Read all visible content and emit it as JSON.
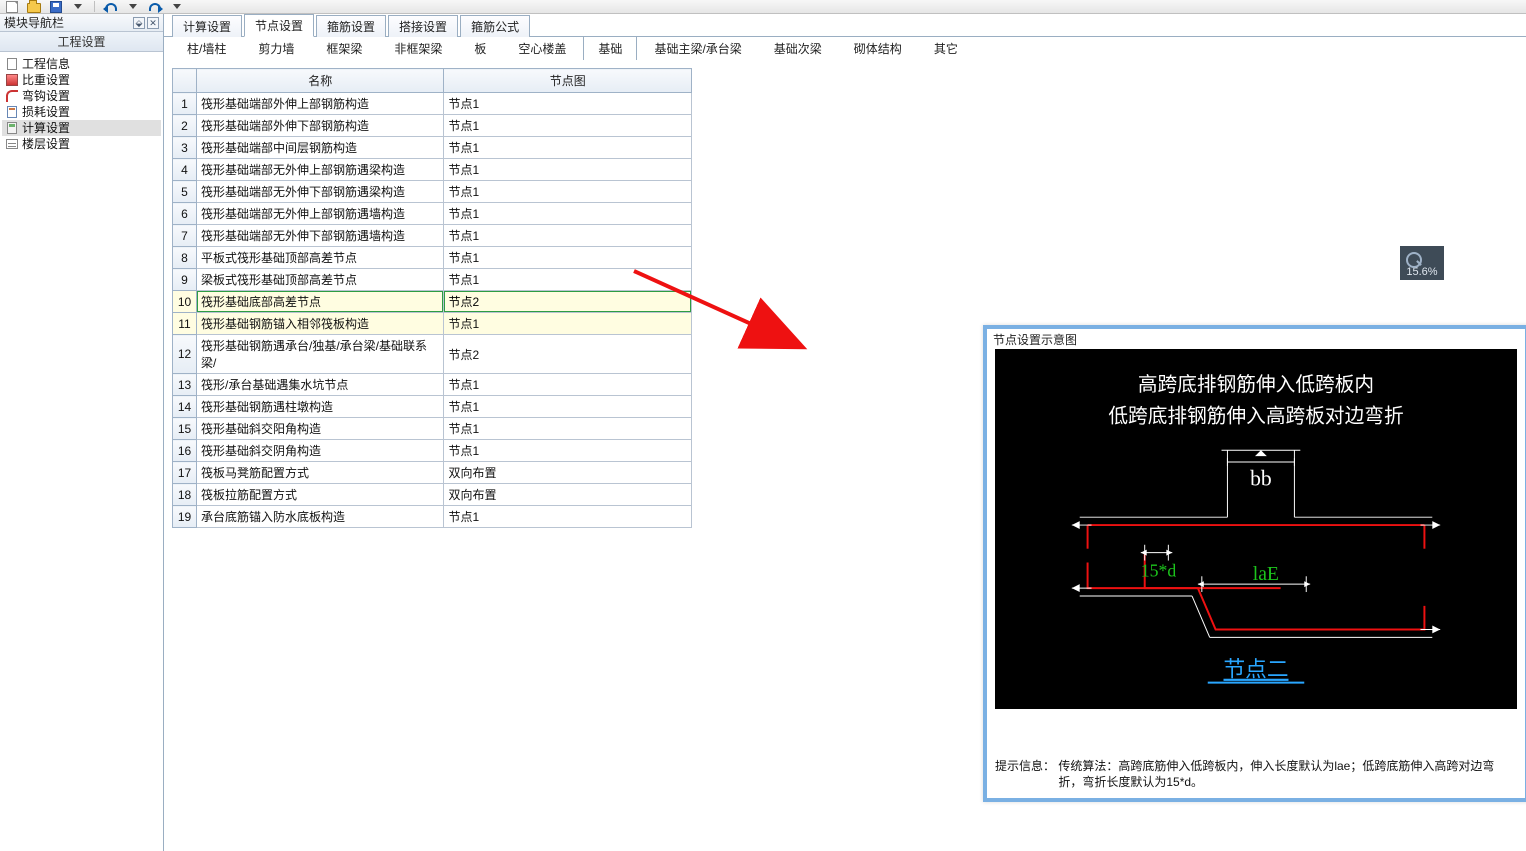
{
  "sidebar": {
    "title": "模块导航栏",
    "pin_glyph": "📌",
    "close_glyph": "✕",
    "title2": "工程设置",
    "items": [
      {
        "label": "工程信息"
      },
      {
        "label": "比重设置"
      },
      {
        "label": "弯钩设置"
      },
      {
        "label": "损耗设置"
      },
      {
        "label": "计算设置"
      },
      {
        "label": "楼层设置"
      }
    ]
  },
  "top_tabs": [
    {
      "label": "计算设置"
    },
    {
      "label": "节点设置"
    },
    {
      "label": "箍筋设置"
    },
    {
      "label": "搭接设置"
    },
    {
      "label": "箍筋公式"
    }
  ],
  "top_tabs_active": 1,
  "sub_tabs": [
    {
      "label": "柱/墙柱"
    },
    {
      "label": "剪力墙"
    },
    {
      "label": "框架梁"
    },
    {
      "label": "非框架梁"
    },
    {
      "label": "板"
    },
    {
      "label": "空心楼盖"
    },
    {
      "label": "基础"
    },
    {
      "label": "基础主梁/承台梁"
    },
    {
      "label": "基础次梁"
    },
    {
      "label": "砌体结构"
    },
    {
      "label": "其它"
    }
  ],
  "sub_tabs_active": 6,
  "table": {
    "headers": {
      "name": "名称",
      "node": "节点图"
    },
    "rows": [
      {
        "n": "1",
        "name": "筏形基础端部外伸上部钢筋构造",
        "val": "节点1"
      },
      {
        "n": "2",
        "name": "筏形基础端部外伸下部钢筋构造",
        "val": "节点1"
      },
      {
        "n": "3",
        "name": "筏形基础端部中间层钢筋构造",
        "val": "节点1"
      },
      {
        "n": "4",
        "name": "筏形基础端部无外伸上部钢筋遇梁构造",
        "val": "节点1"
      },
      {
        "n": "5",
        "name": "筏形基础端部无外伸下部钢筋遇梁构造",
        "val": "节点1"
      },
      {
        "n": "6",
        "name": "筏形基础端部无外伸上部钢筋遇墙构造",
        "val": "节点1"
      },
      {
        "n": "7",
        "name": "筏形基础端部无外伸下部钢筋遇墙构造",
        "val": "节点1"
      },
      {
        "n": "8",
        "name": "平板式筏形基础顶部高差节点",
        "val": "节点1"
      },
      {
        "n": "9",
        "name": "梁板式筏形基础顶部高差节点",
        "val": "节点1"
      },
      {
        "n": "10",
        "name": "筏形基础底部高差节点",
        "val": "节点2"
      },
      {
        "n": "11",
        "name": "筏形基础钢筋锚入相邻筏板构造",
        "val": "节点1"
      },
      {
        "n": "12",
        "name": "筏形基础钢筋遇承台/独基/承台梁/基础联系梁/",
        "val": "节点2"
      },
      {
        "n": "13",
        "name": "筏形/承台基础遇集水坑节点",
        "val": "节点1"
      },
      {
        "n": "14",
        "name": "筏形基础钢筋遇柱墩构造",
        "val": "节点1"
      },
      {
        "n": "15",
        "name": "筏形基础斜交阳角构造",
        "val": "节点1"
      },
      {
        "n": "16",
        "name": "筏形基础斜交阴角构造",
        "val": "节点1"
      },
      {
        "n": "17",
        "name": "筏板马凳筋配置方式",
        "val": "双向布置"
      },
      {
        "n": "18",
        "name": "筏板拉筋配置方式",
        "val": "双向布置"
      },
      {
        "n": "19",
        "name": "承台底筋锚入防水底板构造",
        "val": "节点1"
      }
    ],
    "selected_index": 9
  },
  "dlg": {
    "title": "节点设置示意图",
    "text1": "高跨底排钢筋伸入低跨板内",
    "text2": "低跨底排钢筋伸入高跨板对边弯折",
    "bb": "bb",
    "d15": "15*d",
    "lae": "laE",
    "node2": "节点二",
    "hint_label": "提示信息：",
    "hint_text": "传统算法：高跨底筋伸入低跨板内，伸入长度默认为lae；低跨底筋伸入高跨对边弯折，弯折长度默认为15*d。"
  },
  "zoom": {
    "label": "15.6%"
  }
}
